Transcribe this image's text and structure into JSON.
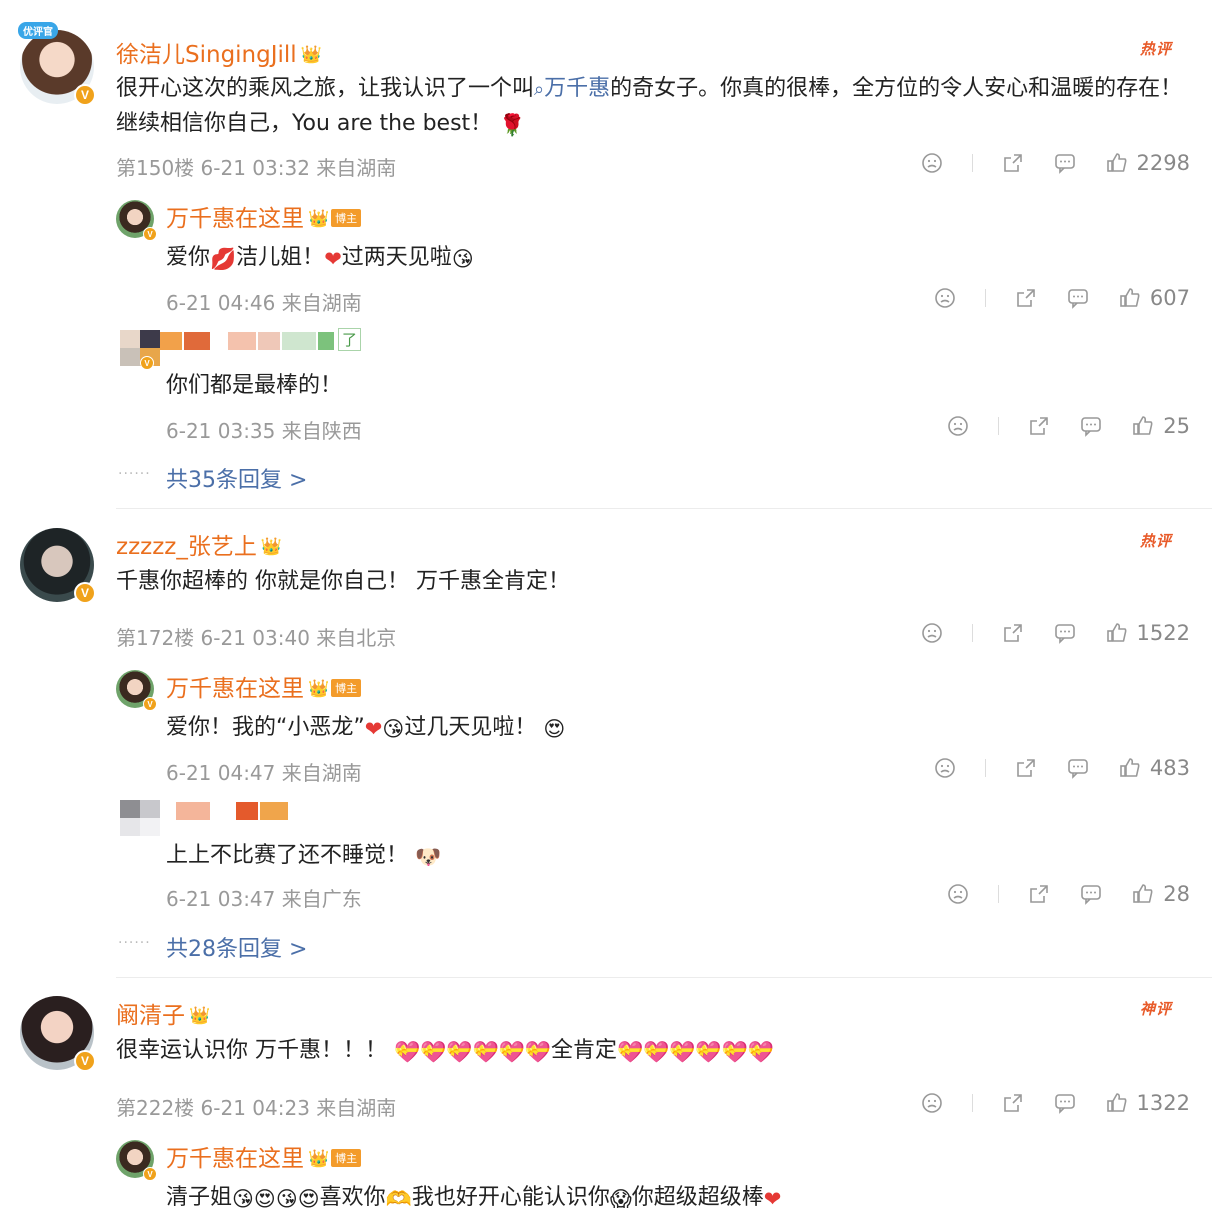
{
  "comments": [
    {
      "user": "徐洁儿SingingJill",
      "user_tag": "优评官",
      "hot_label": "热评",
      "text_pre": "很开心这次的乘风之旅，让我认识了一个叫",
      "text_link": "万千惠",
      "text_post": "的奇女子。你真的很棒，全方位的令人安心和温暖的存在！继续相信你自己，You are the best！",
      "meta": "第150楼 6-21 03:32 来自湖南",
      "likes": "2298",
      "replies": [
        {
          "user": "万千惠在这里",
          "badge": "博主",
          "text_a": "爱你",
          "text_b": "洁儿姐！",
          "text_c": "过两天见啦",
          "meta": "6-21 04:46 来自湖南",
          "likes": "607"
        },
        {
          "user": "",
          "text": "你们都是最棒的！",
          "meta": "6-21 03:35 来自陕西",
          "likes": "25",
          "name_tail": "了"
        }
      ],
      "more": "共35条回复 >"
    },
    {
      "user": "zzzzz_张艺上",
      "hot_label": "热评",
      "text": "千惠你超棒的 你就是你自己！ 万千惠全肯定！",
      "meta": "第172楼 6-21 03:40 来自北京",
      "likes": "1522",
      "replies": [
        {
          "user": "万千惠在这里",
          "badge": "博主",
          "text_a": "爱你！我的“小恶龙”",
          "text_b": "过几天见啦！",
          "meta": "6-21 04:47 来自湖南",
          "likes": "483"
        },
        {
          "user": "",
          "text": "上上不比赛了还不睡觉！",
          "meta": "6-21 03:47 来自广东",
          "likes": "28"
        }
      ],
      "more": "共28条回复 >"
    },
    {
      "user": "阚清子",
      "hot_label": "神评",
      "text_a": "很幸运认识你 万千惠！！！",
      "text_b": "全肯定",
      "meta": "第222楼 6-21 04:23 来自湖南",
      "likes": "1322",
      "replies": [
        {
          "user": "万千惠在这里",
          "badge": "博主",
          "text_a": "清子姐",
          "text_b": "喜欢你",
          "text_c": "我也好开心能认识你",
          "text_d": "你超级超级棒"
        }
      ]
    }
  ],
  "icons": [
    "dislike-icon",
    "share-icon",
    "comment-icon",
    "like-icon",
    "crown-icon",
    "verified-icon",
    "search-icon"
  ],
  "colors": {
    "username": "#ea6f1e",
    "link": "#4b6fa8",
    "meta": "#999999",
    "hot": "#e85b2a",
    "verified": "#f0a21b"
  }
}
